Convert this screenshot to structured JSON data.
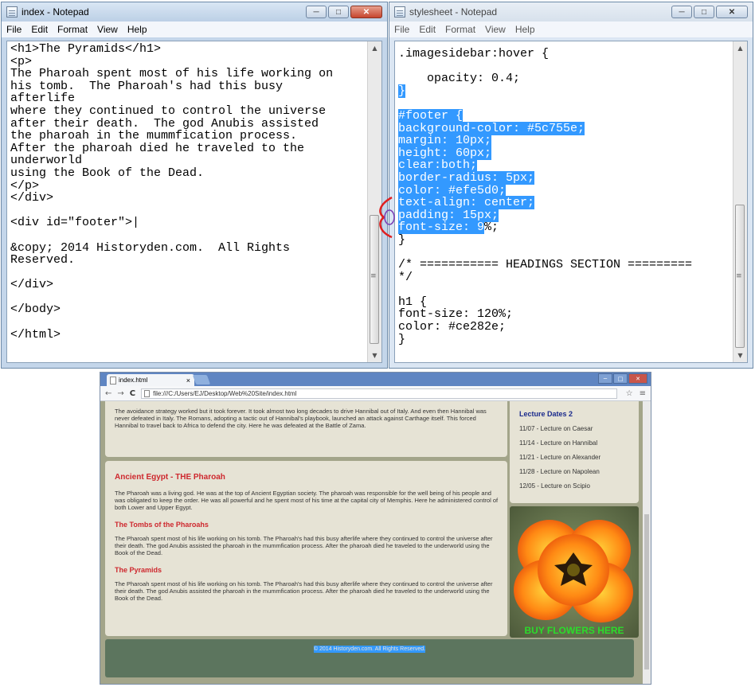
{
  "left_window": {
    "title": "index - Notepad",
    "menu": [
      "File",
      "Edit",
      "Format",
      "View",
      "Help"
    ],
    "code_lines": [
      "<h1>The Pyramids</h1>",
      "<p>",
      "The Pharoah spent most of his life working on",
      "his tomb.  The Pharoah's had this busy",
      "afterlife",
      "where they continued to control the universe",
      "after their death.  The god Anubis assisted",
      "the pharoah in the mummfication process.",
      "After the pharoah died he traveled to the",
      "underworld",
      "using the Book of the Dead.",
      "</p>",
      "</div>",
      "",
      "<div id=\"footer\">|",
      "",
      "&copy; 2014 Historyden.com.  All Rights",
      "Reserved.",
      "",
      "</div>",
      "",
      "</body>",
      "",
      "</html>"
    ]
  },
  "right_window": {
    "title": "stylesheet - Notepad",
    "menu": [
      "File",
      "Edit",
      "Format",
      "View",
      "Help"
    ],
    "lines": [
      {
        "text": ".imagesidebar:hover {",
        "sel": ""
      },
      {
        "text": "",
        "sel": ""
      },
      {
        "text": "    opacity: 0.4;",
        "sel": ""
      },
      {
        "text": "",
        "sel": "}"
      },
      {
        "text": "",
        "sel": ""
      },
      {
        "text": "",
        "sel": "#footer {"
      },
      {
        "text": "",
        "sel": "background-color: #5c755e;"
      },
      {
        "text": "",
        "sel": "margin: 10px;"
      },
      {
        "text": "",
        "sel": "height: 60px;"
      },
      {
        "text": "",
        "sel": "clear:both;"
      },
      {
        "text": "",
        "sel": "border-radius: 5px;"
      },
      {
        "text": "",
        "sel": "color: #efe5d0;"
      },
      {
        "text": "",
        "sel": "text-align: center;"
      },
      {
        "text": "",
        "sel": "padding: 15px;"
      },
      {
        "text": "%;",
        "sel": "font-size: 9",
        "order": "sel-first"
      },
      {
        "text": "}",
        "sel": ""
      },
      {
        "text": "",
        "sel": ""
      },
      {
        "text": "/* =========== HEADINGS SECTION =========",
        "sel": ""
      },
      {
        "text": "*/",
        "sel": ""
      },
      {
        "text": "",
        "sel": ""
      },
      {
        "text": "h1 {",
        "sel": ""
      },
      {
        "text": "font-size: 120%;",
        "sel": ""
      },
      {
        "text": "color: #ce282e;",
        "sel": ""
      },
      {
        "text": "}",
        "sel": ""
      }
    ]
  },
  "browser": {
    "tab_title": "index.html",
    "tab_close": "×",
    "url": "file:///C:/Users/EJ/Desktop/Web%20Site/index.html",
    "top_panel_text": "The avoidance strategy worked but it took forever. It took almost two long decades to drive Hannibal out of Italy. And even then Hannibal was never defeated in Italy. The Romans, adopting a tactic out of Hannibal's playbook, launched an attack against Carthage itself. This forced Hannibal to travel back to Africa to defend the city. Here he was defeated at the Battle of Zama.",
    "sections": [
      {
        "heading": "Ancient Egypt - THE Pharoah",
        "text": "The Pharoah was a living god. He was at the top of Ancient Egyptian society. The pharoah was responsible for the well being of his people and was obligated to keep the order. He was all powerful and he spent most of his time at the capital city of Memphis. Here he administered control of both Lower and Upper Egypt."
      },
      {
        "heading": "The Tombs of the Pharoahs",
        "text": "The Pharoah spent most of his life working on his tomb. The Pharoah's had this busy afterlife where they continued to control the universe after their death. The god Anubis assisted the pharoah in the mummfication process. After the pharoah died he traveled to the underworld using the Book of the Dead."
      },
      {
        "heading": "The Pyramids",
        "text": "The Pharoah spent most of his life working on his tomb. The Pharoah's had this busy afterlife where they continued to control the universe after their death. The god Anubis assisted the pharoah in the mummfication process. After the pharoah died he traveled to the underworld using the Book of the Dead."
      }
    ],
    "lectures": {
      "title": "Lecture Dates 2",
      "items": [
        "11/07 - Lecture on Caesar",
        "11/14 - Lecture on Hannibal",
        "11/21 - Lecture on Alexander",
        "11/28 - Lecture on Napolean",
        "12/05 - Lecture on Scipio"
      ]
    },
    "flower_caption": "BUY FLOWERS HERE",
    "footer_text": "© 2014 Historyden.com. All Rights Reserved."
  },
  "colors": {
    "footer_bg": "#5c755e",
    "footer_text": "#efe5d0",
    "heading": "#ce282e",
    "selection": "#3399ff"
  },
  "icons": [
    "notepad-icon",
    "minimize-icon",
    "maximize-icon",
    "close-icon",
    "back-icon",
    "forward-icon",
    "reload-icon",
    "page-icon",
    "star-icon",
    "menu-icon"
  ]
}
